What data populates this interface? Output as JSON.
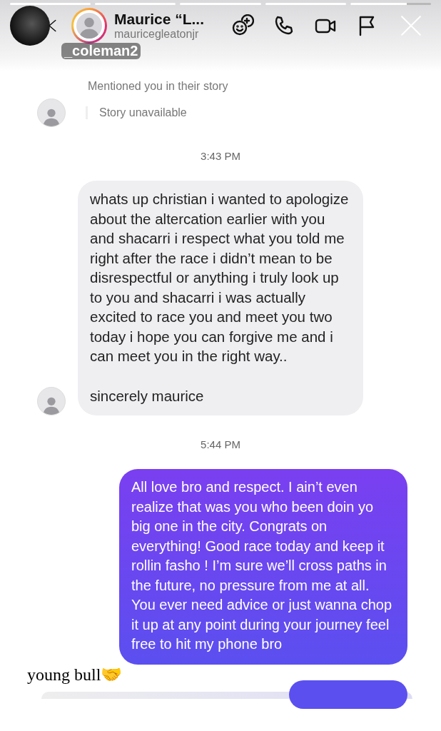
{
  "story": {
    "segments": [
      {
        "level": 1
      },
      {
        "level": 1
      },
      {
        "level": 1
      },
      {
        "level": 1
      },
      {
        "level": 0.7
      }
    ],
    "username": "_coleman2"
  },
  "header": {
    "name": "Maurice “L...",
    "handle": "mauricegleatonjr"
  },
  "mention": {
    "note": "Mentioned you in their story",
    "story_status": "Story unavailable"
  },
  "messages": [
    {
      "kind": "time",
      "text": "3:43 PM"
    },
    {
      "kind": "incoming",
      "paragraphs": [
        "whats up christian i wanted to apologize about the altercation earlier with you and shacarri i respect what you told me right after the race i didn’t mean to be disrespectful or anything i truly look up to you and shacarri i was actually excited to race you and meet you two today i hope you can forgive me and i can meet you in the right way..",
        "sincerely maurice"
      ]
    },
    {
      "kind": "time",
      "text": "5:44 PM"
    },
    {
      "kind": "outgoing",
      "paragraphs": [
        "All love bro and respect. I ain’t even realize that was you who been doin yo big one in the city. Congrats on everything! Good race today and keep it rollin fasho ! I’m sure we’ll cross paths in the future, no pressure from me at all. You ever need advice or just wanna chop it up at any point during your journey feel free to hit my phone bro"
      ]
    }
  ],
  "caption": "young bull🤝"
}
